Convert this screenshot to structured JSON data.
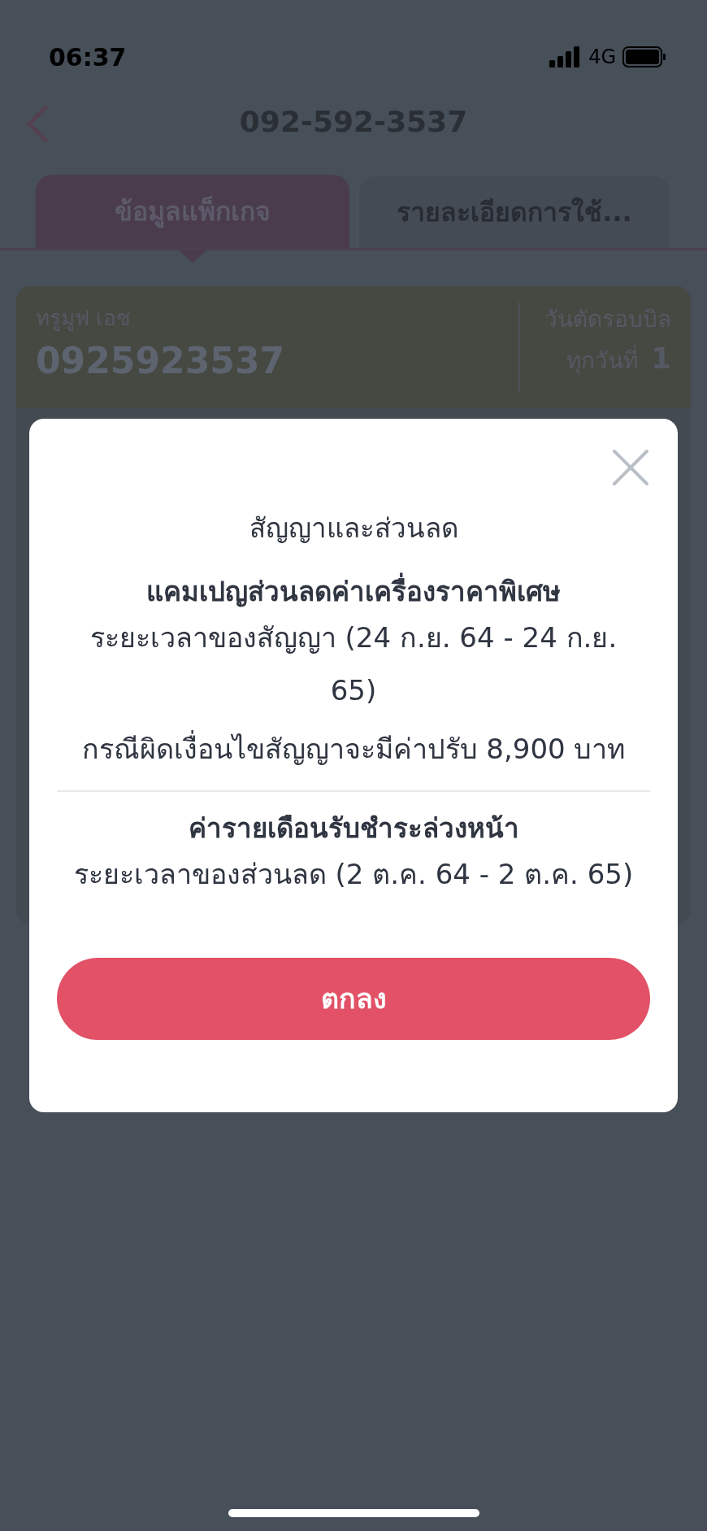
{
  "status_bar": {
    "time": "06:37",
    "network": "4G"
  },
  "header": {
    "title": "092-592-3537"
  },
  "tabs": [
    {
      "label": "ข้อมูลแพ็กเกจ",
      "selected": true
    },
    {
      "label": "รายละเอียดการใช้...",
      "selected": false
    }
  ],
  "card": {
    "plan_name": "ทรูมูฟ เอช",
    "number": "0925923537",
    "billing_label": "วันตัดรอบบิล",
    "billing_prefix": "ทุกวันที่",
    "billing_day": "1"
  },
  "modal": {
    "title": "สัญญาและส่วนลด",
    "sections": [
      {
        "heading": "แคมเปญส่วนลดค่าเครื่องราคาพิเศษ",
        "lines": [
          "ระยะเวลาของสัญญา (24 ก.ย. 64 - 24 ก.ย. 65)",
          "กรณีผิดเงื่อนไขสัญญาจะมีค่าปรับ 8,900 บาท"
        ]
      },
      {
        "heading": "ค่ารายเดือนรับชำระล่วงหน้า",
        "lines": [
          "ระยะเวลาของส่วนลด (2 ต.ค. 64 - 2 ต.ค. 65)"
        ]
      }
    ],
    "button": "ตกลง"
  }
}
